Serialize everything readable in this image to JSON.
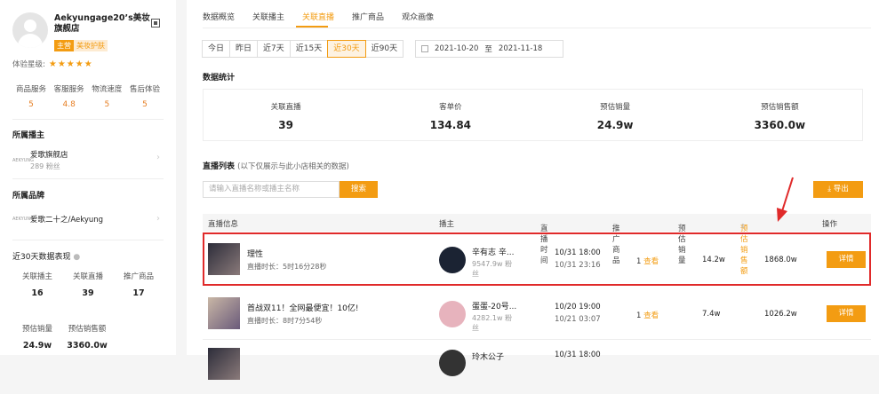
{
  "shop": {
    "name": "Aekyungage20’s美妆旗舰店",
    "tag_main": "主营",
    "tag_category": "美妆护肤",
    "rating_label": "体验星级:",
    "stars": "★★★★★",
    "scores": [
      {
        "label": "商品服务",
        "value": "5"
      },
      {
        "label": "客服服务",
        "value": "4.8"
      },
      {
        "label": "物流速度",
        "value": "5"
      },
      {
        "label": "售后体验",
        "value": "5"
      }
    ]
  },
  "anchor_section": {
    "title": "所属播主",
    "logo_text": "AEKYUNG",
    "name": "爱歌旗舰店",
    "fans": "289 粉丝"
  },
  "brand_section": {
    "title": "所属品牌",
    "logo_text": "AEKYUNG",
    "name": "爱歌二十之/Aekyung"
  },
  "recent_section": {
    "title": "近30天数据表现",
    "stats_row1": [
      {
        "label": "关联播主",
        "value": "16"
      },
      {
        "label": "关联直播",
        "value": "39"
      },
      {
        "label": "推广商品",
        "value": "17"
      }
    ],
    "stats_row2": [
      {
        "label": "预估销量",
        "value": "24.9w"
      },
      {
        "label": "预估销售额",
        "value": "3360.0w"
      }
    ]
  },
  "tabs": [
    "数据概览",
    "关联播主",
    "关联直播",
    "推广商品",
    "观众画像"
  ],
  "range_buttons": [
    "今日",
    "昨日",
    "近7天",
    "近15天",
    "近30天",
    "近90天"
  ],
  "date_range": {
    "start": "2021-10-20",
    "sep": "至",
    "end": "2021-11-18"
  },
  "stats_title": "数据统计",
  "stats": [
    {
      "label": "关联直播",
      "value": "39"
    },
    {
      "label": "客单价",
      "value": "134.84"
    },
    {
      "label": "预估销量",
      "value": "24.9w"
    },
    {
      "label": "预估销售额",
      "value": "3360.0w"
    }
  ],
  "list_title": "直播列表",
  "list_subtitle": "(以下仅展示与此小店相关的数据)",
  "search_placeholder": "请输入直播名称或播主名称",
  "search_button": "搜索",
  "export_button": "导出",
  "columns": {
    "info": "直播信息",
    "anchor": "播主",
    "time": "直播时间",
    "products": "推广商品",
    "sales_volume": "预估销量",
    "sales_amount": "预估销售额",
    "action": "操作"
  },
  "rows": [
    {
      "title": "理性",
      "duration": "直播时长：5时16分28秒",
      "anchor": "辛有志 辛...",
      "fans": "9547.9w 粉丝",
      "start": "10/31 18:00",
      "end": "10/31 23:16",
      "count": "1",
      "view": "查看",
      "volume": "14.2w",
      "amount": "1868.0w",
      "action": "详情"
    },
    {
      "title": "首战双11！全网最便宜！10亿!",
      "duration": "直播时长：8时7分54秒",
      "anchor": "蛋蛋-20号...",
      "fans": "4282.1w 粉丝",
      "start": "10/20 19:00",
      "end": "10/21 03:07",
      "count": "1",
      "view": "查看",
      "volume": "7.4w",
      "amount": "1026.2w",
      "action": "详情"
    },
    {
      "anchor": "玲木公子",
      "start": "10/31 18:00"
    }
  ]
}
